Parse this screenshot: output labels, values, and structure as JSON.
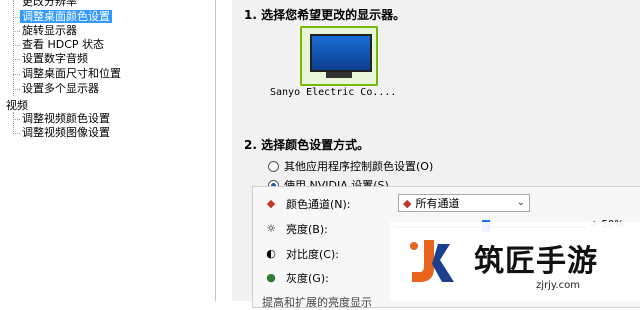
{
  "nav": {
    "top_cut_item": "更改分辨率",
    "display_items": [
      {
        "label": "调整桌面颜色设置",
        "selected": true
      },
      {
        "label": "旋转显示器",
        "selected": false
      },
      {
        "label": "查看 HDCP 状态",
        "selected": false
      },
      {
        "label": "设置数字音频",
        "selected": false
      },
      {
        "label": "调整桌面尺寸和位置",
        "selected": false
      },
      {
        "label": "设置多个显示器",
        "selected": false
      }
    ],
    "video_category": "视频",
    "video_items": [
      {
        "label": "调整视频颜色设置"
      },
      {
        "label": "调整视频图像设置"
      }
    ]
  },
  "main": {
    "step1_title": "1.  选择您希望更改的显示器。",
    "monitor_label": "Sanyo Electric Co....",
    "step2_title": "2.  选择颜色设置方式。",
    "radio_other_app": "其他应用程序控制颜色设置(O)",
    "radio_nvidia": "使用 NVIDIA 设置(S)",
    "selected_radio": "radio_nvidia",
    "color_channel_label": "颜色通道(N):",
    "color_channel_value": "所有通道",
    "brightness_label": "亮度(B):",
    "brightness_value_text": "+ 50%",
    "contrast_label": "对比度(C):",
    "gamma_label": "灰度(G):",
    "cut_bottom_text": "提高和扩展的亮度显示"
  },
  "watermark": {
    "brand": "筑匠手游",
    "url": "zjrjy.com"
  },
  "colors": {
    "selection_blue": "#3399ff",
    "nvidia_green": "#76b900",
    "slider_blue": "#1a73e8"
  }
}
